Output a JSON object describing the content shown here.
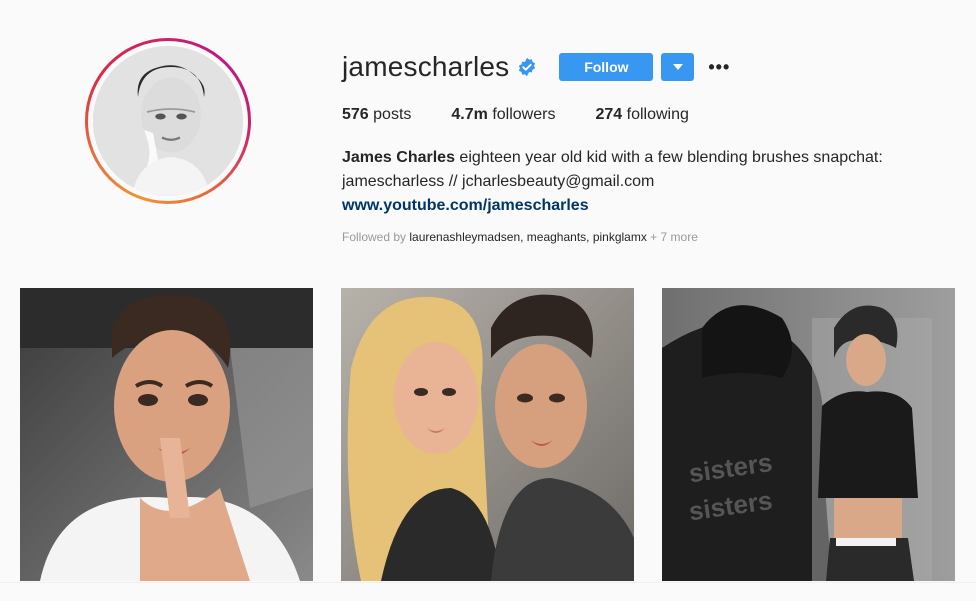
{
  "profile": {
    "username": "jamescharles",
    "follow_label": "Follow",
    "more_label": "•••",
    "stats": {
      "posts_count": "576",
      "posts_label": "posts",
      "followers_count": "4.7m",
      "followers_label": "followers",
      "following_count": "274",
      "following_label": "following"
    },
    "bio": {
      "full_name": "James Charles",
      "text_line1": " eighteen year old kid with a few blending brushes snapchat:",
      "text_line2": "jamescharless // jcharlesbeauty@gmail.com",
      "link": "www.youtube.com/jamescharles"
    },
    "followed_by": {
      "prefix": "Followed by ",
      "names": "laurenashleymadsen, meaghants, pinkglamx",
      "more": " + 7 more"
    }
  },
  "colors": {
    "accent": "#3897f0",
    "link": "#003569",
    "muted": "#999999",
    "text": "#262626",
    "background": "#fafafa"
  },
  "icons": {
    "verified": "verified-badge-icon",
    "dropdown": "caret-down-icon",
    "more": "more-options-icon"
  },
  "posts": [
    {
      "name": "post-1",
      "description_icon": "portrait"
    },
    {
      "name": "post-2",
      "description_icon": "portrait"
    },
    {
      "name": "post-3",
      "description_icon": "portrait"
    }
  ]
}
